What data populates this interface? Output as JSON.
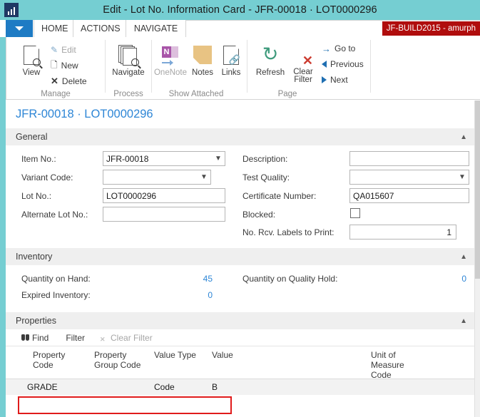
{
  "window": {
    "title": "Edit - Lot No. Information Card - JFR-00018 · LOT0000296",
    "logo_icon": "dynamics-nav-logo-icon"
  },
  "tabs": {
    "app_menu_icon": "chevron-down-icon",
    "items": [
      {
        "label": "HOME",
        "active": true
      },
      {
        "label": "ACTIONS",
        "active": false
      },
      {
        "label": "NAVIGATE",
        "active": false
      }
    ],
    "build_badge": "JF-BUILD2015 - amurph"
  },
  "ribbon": {
    "groups": [
      {
        "name": "Manage",
        "label": "Manage",
        "big_buttons": [
          {
            "label": "View",
            "icon": "view-document-search-icon",
            "disabled": false
          }
        ],
        "small_buttons": [
          {
            "label": "Edit",
            "icon": "pencil-icon",
            "disabled": true
          },
          {
            "label": "New",
            "icon": "new-document-icon",
            "disabled": false
          },
          {
            "label": "Delete",
            "icon": "delete-x-icon",
            "disabled": false
          }
        ]
      },
      {
        "name": "Process",
        "label": "Process",
        "big_buttons": [
          {
            "label": "Navigate",
            "icon": "navigate-documents-search-icon",
            "disabled": false
          }
        ],
        "small_buttons": []
      },
      {
        "name": "Show Attached",
        "label": "Show Attached",
        "big_buttons": [
          {
            "label": "OneNote",
            "icon": "onenote-icon",
            "disabled": true
          },
          {
            "label": "Notes",
            "icon": "sticky-note-icon",
            "disabled": false
          },
          {
            "label": "Links",
            "icon": "links-chain-icon",
            "disabled": false
          }
        ],
        "small_buttons": []
      },
      {
        "name": "Page",
        "label": "Page",
        "big_buttons": [
          {
            "label": "Refresh",
            "icon": "refresh-circular-arrows-icon",
            "disabled": false
          },
          {
            "label": "Clear Filter",
            "icon": "clear-filter-funnel-x-icon",
            "disabled": false
          }
        ],
        "small_buttons": [
          {
            "label": "Go to",
            "icon": "arrow-right-icon",
            "disabled": false
          },
          {
            "label": "Previous",
            "icon": "triangle-left-icon",
            "disabled": false
          },
          {
            "label": "Next",
            "icon": "triangle-right-icon",
            "disabled": false
          }
        ]
      }
    ]
  },
  "page": {
    "heading": "JFR-00018 · LOT0000296"
  },
  "general": {
    "title": "General",
    "collapse_icon": "chevron-up-icon",
    "left_fields": [
      {
        "label": "Item No.:",
        "value": "JFR-00018",
        "type": "dropdown"
      },
      {
        "label": "Variant Code:",
        "value": "",
        "type": "dropdown"
      },
      {
        "label": "Lot No.:",
        "value": "LOT0000296",
        "type": "text"
      },
      {
        "label": "Alternate Lot No.:",
        "value": "",
        "type": "text"
      }
    ],
    "right_fields": [
      {
        "label": "Description:",
        "value": "",
        "type": "text"
      },
      {
        "label": "Test Quality:",
        "value": "",
        "type": "dropdown"
      },
      {
        "label": "Certificate Number:",
        "value": "QA015607",
        "type": "text"
      },
      {
        "label": "Blocked:",
        "value": "",
        "type": "checkbox",
        "checked": false
      },
      {
        "label": "No. Rcv. Labels to Print:",
        "value": "1",
        "type": "number"
      }
    ]
  },
  "inventory": {
    "title": "Inventory",
    "collapse_icon": "chevron-up-icon",
    "left_fields": [
      {
        "label": "Quantity on Hand:",
        "value": "45"
      },
      {
        "label": "Expired Inventory:",
        "value": "0"
      }
    ],
    "right_fields": [
      {
        "label": "Quantity on Quality Hold:",
        "value": "0"
      }
    ]
  },
  "properties": {
    "title": "Properties",
    "collapse_icon": "chevron-up-icon",
    "toolbar": [
      {
        "label": "Find",
        "icon": "binoculars-icon",
        "disabled": false
      },
      {
        "label": "Filter",
        "icon": "filter-icon",
        "disabled": false
      },
      {
        "label": "Clear Filter",
        "icon": "clear-filter-icon",
        "disabled": true
      }
    ],
    "columns": [
      {
        "label": "Property Code"
      },
      {
        "label": "Property Group Code"
      },
      {
        "label": "Value Type"
      },
      {
        "label": "Value"
      },
      {
        "label": "Unit of Measure Code"
      }
    ],
    "rows": [
      {
        "property_code": "GRADE",
        "property_group_code": "",
        "value_type": "Code",
        "value": "B",
        "unit_of_measure_code": "",
        "highlighted": true
      }
    ]
  },
  "colors": {
    "titlebar_teal": "#75ced2",
    "accent_blue": "#2e86d6",
    "badge_red": "#b00d0d",
    "annotation_red": "#e01b1b",
    "section_gray": "#efefef"
  }
}
